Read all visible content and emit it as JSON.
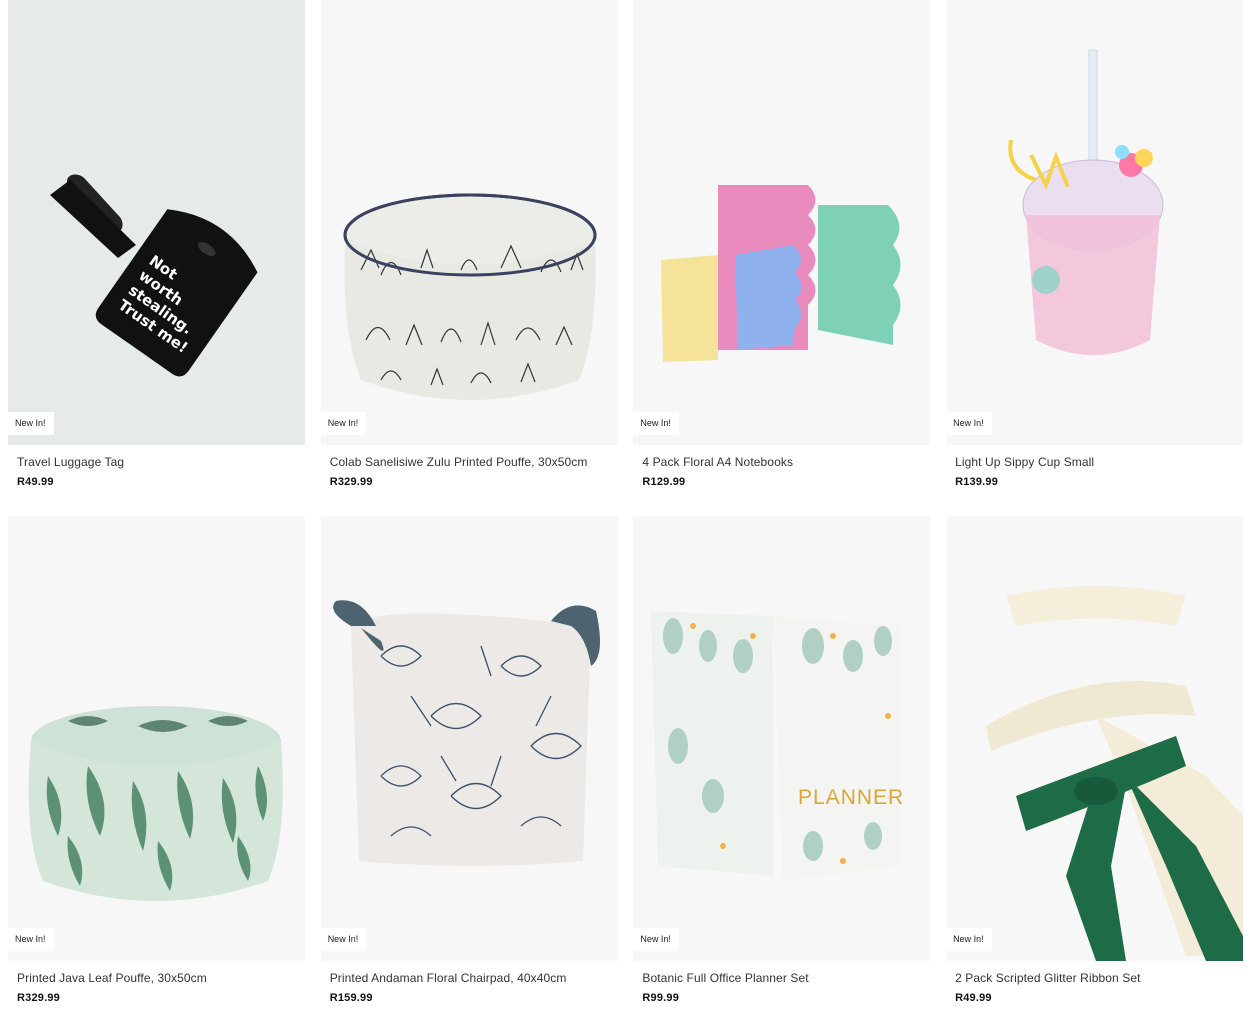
{
  "products": [
    {
      "title": "Travel Luggage Tag",
      "price": "R49.99",
      "badge": "New In!",
      "tag_text": "Not worth stealing. Trust me!",
      "image": "luggage-tag-image"
    },
    {
      "title": "Colab Sanelisiwe Zulu Printed Pouffe, 30x50cm",
      "price": "R329.99",
      "badge": "New In!",
      "image": "printed-pouffe-image"
    },
    {
      "title": "4 Pack Floral A4 Notebooks",
      "price": "R129.99",
      "badge": "New In!",
      "image": "notebooks-image"
    },
    {
      "title": "Light Up Sippy Cup Small",
      "price": "R139.99",
      "badge": "New In!",
      "image": "sippy-cup-image"
    },
    {
      "title": "Printed Java Leaf Pouffe, 30x50cm",
      "price": "R329.99",
      "badge": "New In!",
      "image": "leaf-pouffe-image"
    },
    {
      "title": "Printed Andaman Floral Chairpad, 40x40cm",
      "price": "R159.99",
      "badge": "New In!",
      "image": "chairpad-image"
    },
    {
      "title": "Botanic Full Office Planner Set",
      "price": "R99.99",
      "badge": "New In!",
      "planner_text": "PLANNER",
      "image": "planner-image"
    },
    {
      "title": "2 Pack Scripted Glitter Ribbon Set",
      "price": "R49.99",
      "badge": "New In!",
      "image": "ribbon-set-image"
    }
  ],
  "colors": {
    "badge_bg": "#ffffff",
    "card_bg": "#f7f7f7",
    "price": "#111111"
  }
}
